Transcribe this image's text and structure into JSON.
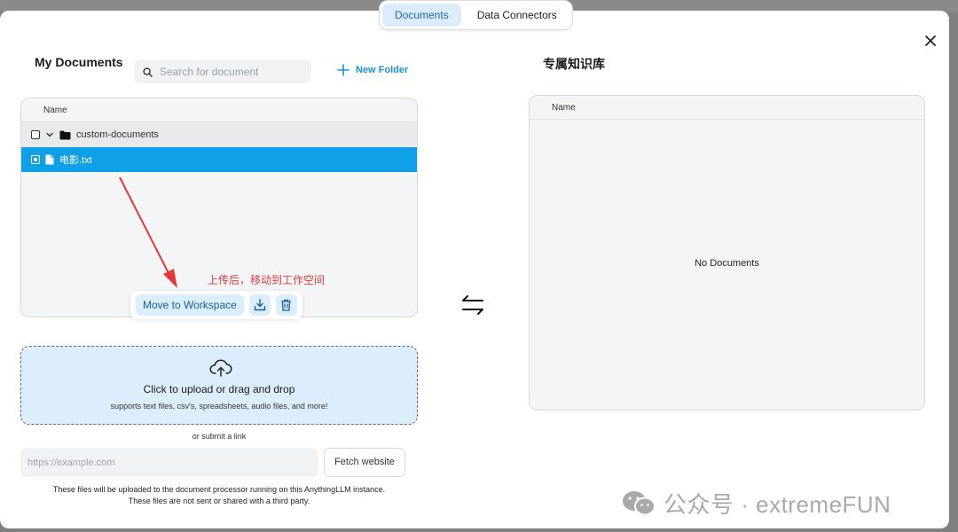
{
  "tabs": [
    {
      "label": "Documents",
      "active": true
    },
    {
      "label": "Data Connectors",
      "active": false
    }
  ],
  "left": {
    "title": "My Documents",
    "search_placeholder": "Search for document",
    "new_folder_label": "New Folder",
    "table_header": "Name",
    "rows": [
      {
        "type": "folder",
        "name": "custom-documents",
        "checked": false,
        "expanded": true
      },
      {
        "type": "file",
        "name": "电影.txt",
        "checked": true,
        "selected": true
      }
    ],
    "action_bar": {
      "move_label": "Move to Workspace",
      "embed_icon": "embed-icon",
      "delete_icon": "trash-icon"
    },
    "annotation": "上传后，移动到工作空间",
    "upload": {
      "title": "Click to upload or drag and drop",
      "subtitle": "supports text files, csv's, spreadsheets, audio files, and more!"
    },
    "or_link": "or submit a link",
    "url_placeholder": "https://example.com",
    "fetch_label": "Fetch website",
    "note_line1": "These files will be uploaded to the document processor running on this AnythingLLM instance.",
    "note_line2": "These files are not sent or shared with a third party."
  },
  "right": {
    "title": "专属知识库",
    "table_header": "Name",
    "empty_message": "No Documents"
  },
  "watermark": "公众号 · extremeFUN",
  "colors": {
    "accent": "#1a90d9",
    "selected_row": "#10a0e8",
    "annotation": "#e53935",
    "upload_bg": "#dceefb"
  }
}
